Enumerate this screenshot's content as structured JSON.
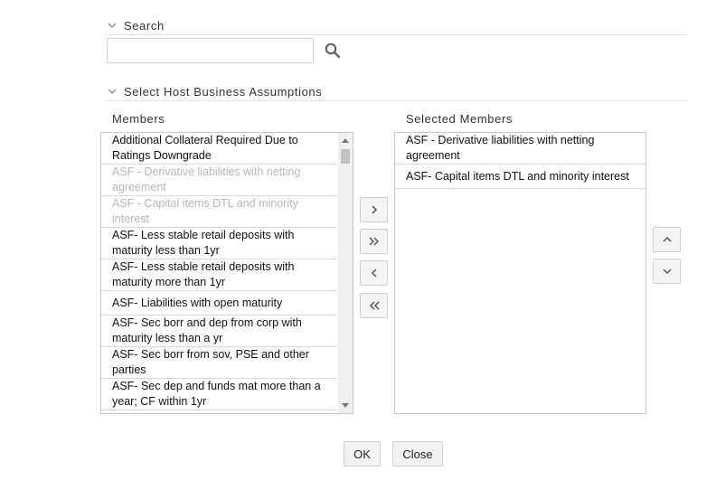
{
  "search_section": {
    "title": "Search",
    "input_value": ""
  },
  "assumptions_section": {
    "title": "Select Host Business Assumptions"
  },
  "members": {
    "label": "Members",
    "items": [
      {
        "label": "Additional Collateral Required Due to Ratings Downgrade",
        "disabled": false
      },
      {
        "label": "ASF - Derivative liabilities with netting agreement",
        "disabled": true
      },
      {
        "label": "ASF - Capital items DTL and minority interest",
        "disabled": true
      },
      {
        "label": "ASF- Less stable retail deposits with maturity less than 1yr",
        "disabled": false
      },
      {
        "label": "ASF- Less stable retail deposits with maturity more than 1yr",
        "disabled": false
      },
      {
        "label": "ASF- Liabilities with open maturity",
        "disabled": false
      },
      {
        "label": "ASF- Sec borr and dep from corp with maturity less than a yr",
        "disabled": false
      },
      {
        "label": "ASF- Sec borr from sov, PSE and other parties",
        "disabled": false
      },
      {
        "label": "ASF- Sec dep and funds mat more than a year; CF within 1yr",
        "disabled": false
      }
    ]
  },
  "selected_members": {
    "label": "Selected Members",
    "items": [
      {
        "label": "ASF - Derivative liabilities with netting agreement"
      },
      {
        "label": "ASF- Capital items DTL and minority interest"
      }
    ]
  },
  "buttons": {
    "ok": "OK",
    "close": "Close"
  },
  "colors": {
    "icon": "#666666",
    "disabled_text": "#b7b7b7",
    "border": "#c9c9c9"
  }
}
